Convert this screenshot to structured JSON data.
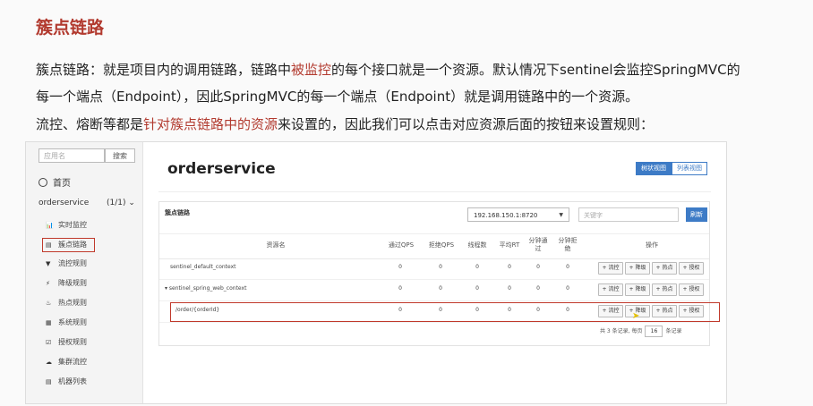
{
  "doc": {
    "title": "簇点链路",
    "p1_a": "簇点链路：就是项目内的调用链路，链路中",
    "p1_hl": "被监控",
    "p1_b": "的每个接口就是一个资源。默认情况下sentinel会监控SpringMVC的",
    "p2": "每一个端点（Endpoint），因此SpringMVC的每一个端点（Endpoint）就是调用链路中的一个资源。",
    "p3_a": "流控、熔断等都是",
    "p3_hl": "针对簇点链路中的资源",
    "p3_b": "来设置的，因此我们可以点击对应资源后面的按钮来设置规则："
  },
  "sidebar": {
    "search_placeholder": "应用名",
    "search_button": "搜索",
    "home": "首页",
    "app_name": "orderservice",
    "app_count": "(1/1)",
    "items": [
      {
        "label": "实时监控",
        "icon": "bar-chart-icon",
        "glyph": "📊"
      },
      {
        "label": "簇点链路",
        "icon": "list-icon",
        "glyph": "▤"
      },
      {
        "label": "流控规则",
        "icon": "filter-icon",
        "glyph": "▼"
      },
      {
        "label": "降级规则",
        "icon": "flash-icon",
        "glyph": "⚡"
      },
      {
        "label": "热点规则",
        "icon": "fire-icon",
        "glyph": "♨"
      },
      {
        "label": "系统规则",
        "icon": "system-icon",
        "glyph": "▦"
      },
      {
        "label": "授权规则",
        "icon": "check-icon",
        "glyph": "☑"
      },
      {
        "label": "集群流控",
        "icon": "cloud-icon",
        "glyph": "☁"
      },
      {
        "label": "机器列表",
        "icon": "table-icon",
        "glyph": "▤"
      }
    ]
  },
  "main": {
    "title": "orderservice",
    "view_tree": "树状视图",
    "view_list": "列表视图",
    "panel_title": "簇点链路",
    "ip_selected": "192.168.150.1:8720",
    "keyword_placeholder": "关键字",
    "refresh": "刷新",
    "columns": [
      "资源名",
      "通过QPS",
      "拒绝QPS",
      "线程数",
      "平均RT",
      "分钟通过",
      "分钟拒绝",
      "操作"
    ],
    "rows": [
      {
        "name": "sentinel_default_context",
        "values": [
          "0",
          "0",
          "0",
          "0",
          "0",
          "0"
        ]
      },
      {
        "name": "▾ sentinel_spring_web_context",
        "values": [
          "0",
          "0",
          "0",
          "0",
          "0",
          "0"
        ]
      },
      {
        "name": "/order/{orderId}",
        "values": [
          "0",
          "0",
          "0",
          "0",
          "0",
          "0"
        ]
      }
    ],
    "ops": [
      "+ 流控",
      "+ 降级",
      "+ 热点",
      "+ 授权"
    ],
    "pager_text": "共 3 条记录, 每页",
    "page_size": "16",
    "pager_suffix": "条记录"
  }
}
